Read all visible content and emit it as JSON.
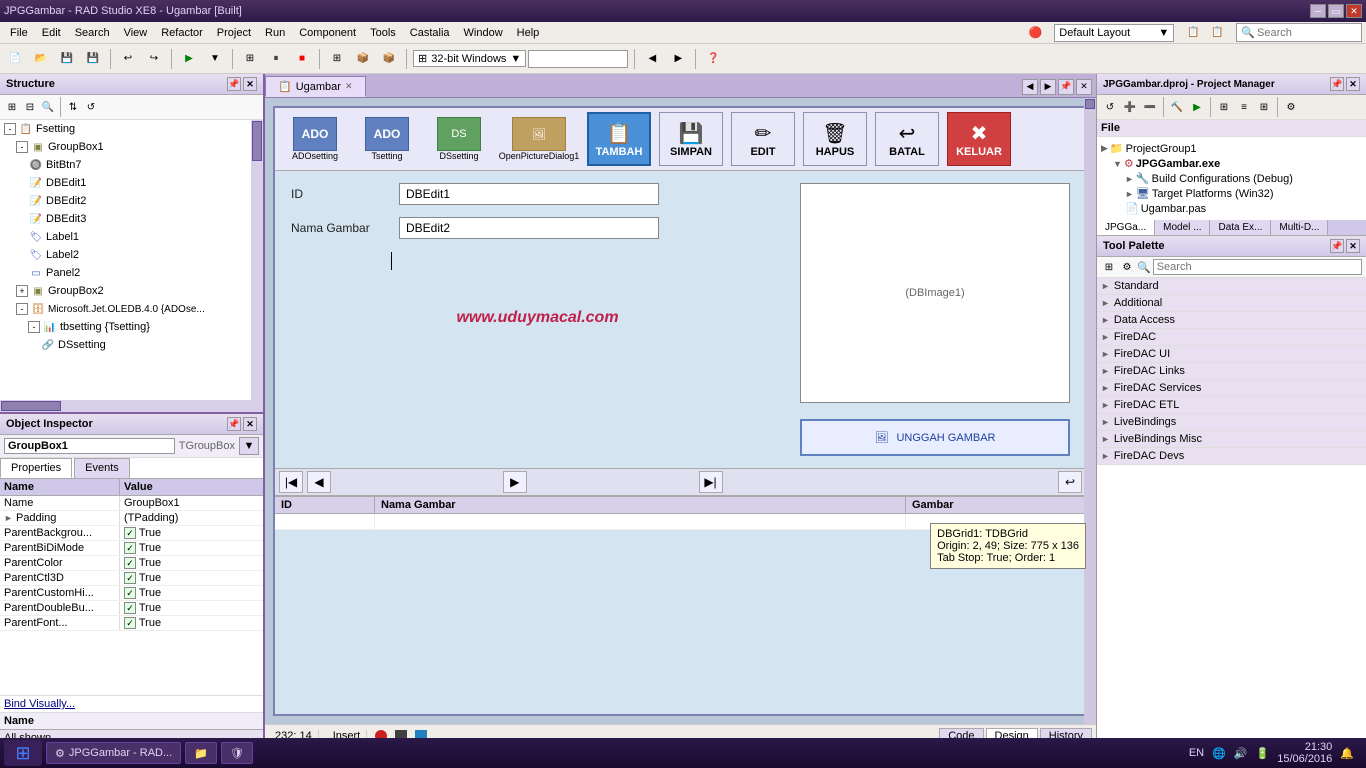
{
  "titleBar": {
    "title": "JPGGambar - RAD Studio XE8 - Ugambar [Built]",
    "buttons": [
      "minimize",
      "restore",
      "close"
    ]
  },
  "menuBar": {
    "items": [
      "File",
      "Edit",
      "Search",
      "View",
      "Refactor",
      "Project",
      "Run",
      "Component",
      "Tools",
      "Castalia",
      "Window",
      "Help"
    ]
  },
  "toolbar": {
    "layout_label": "Default Layout",
    "search_placeholder": "Search",
    "platform_label": "32-bit Windows"
  },
  "structure": {
    "title": "Structure",
    "tree": [
      {
        "label": "Fsetting",
        "level": 0,
        "expanded": true,
        "icon": "form"
      },
      {
        "label": "GroupBox1",
        "level": 1,
        "expanded": true,
        "icon": "group"
      },
      {
        "label": "BitBtn7",
        "level": 2,
        "expanded": false,
        "icon": "btn"
      },
      {
        "label": "DBEdit1",
        "level": 2,
        "expanded": false,
        "icon": "edit"
      },
      {
        "label": "DBEdit2",
        "level": 2,
        "expanded": false,
        "icon": "edit"
      },
      {
        "label": "DBEdit3",
        "level": 2,
        "expanded": false,
        "icon": "edit"
      },
      {
        "label": "Label1",
        "level": 2,
        "expanded": false,
        "icon": "label"
      },
      {
        "label": "Label2",
        "level": 2,
        "expanded": false,
        "icon": "label"
      },
      {
        "label": "Panel2",
        "level": 2,
        "expanded": false,
        "icon": "panel"
      },
      {
        "label": "GroupBox2",
        "level": 1,
        "expanded": false,
        "icon": "group"
      },
      {
        "label": "Microsoft.Jet.OLEDB.4.0 {ADOse...",
        "level": 1,
        "expanded": false,
        "icon": "db"
      },
      {
        "label": "tbsetting {Tsetting}",
        "level": 2,
        "expanded": true,
        "icon": "table"
      },
      {
        "label": "DSsetting",
        "level": 3,
        "expanded": false,
        "icon": "ds"
      }
    ]
  },
  "objectInspector": {
    "title": "Object Inspector",
    "selected_component": "GroupBox1",
    "selected_type": "TGroupBox",
    "tabs": [
      "Properties",
      "Events"
    ],
    "active_tab": "Properties",
    "columns": [
      "Name",
      "Value"
    ],
    "properties": [
      {
        "name": "Name",
        "value": "GroupBox1",
        "has_expand": false
      },
      {
        "name": "Padding",
        "value": "(TPadding)",
        "has_expand": true
      },
      {
        "name": "ParentBackgrou...",
        "value": "True",
        "has_check": true
      },
      {
        "name": "ParentBiDiMode",
        "value": "True",
        "has_check": true
      },
      {
        "name": "ParentColor",
        "value": "True",
        "has_check": true
      },
      {
        "name": "ParentCtl3D",
        "value": "True",
        "has_check": true
      },
      {
        "name": "ParentCustomHi...",
        "value": "True",
        "has_check": true
      },
      {
        "name": "ParentDoubleBu...",
        "value": "True",
        "has_check": true
      },
      {
        "name": "ParentFont...",
        "value": "True",
        "has_check": true
      }
    ],
    "bind_label": "Bind Visually...",
    "bottom_label": "Name",
    "status": "All shown"
  },
  "mainEditor": {
    "tabs": [
      {
        "label": "Ugambar",
        "active": true,
        "icon": "form"
      }
    ],
    "formButtons": [
      {
        "label": "ADOsetting",
        "icon": "ADO",
        "type": "component"
      },
      {
        "label": "Tsetting",
        "icon": "ADO",
        "type": "component"
      },
      {
        "label": "DSsetting",
        "icon": "DS",
        "type": "component"
      },
      {
        "label": "OpenPictureDialog1",
        "icon": "OPD",
        "type": "component"
      },
      {
        "label": "TAMBAH",
        "icon": "+",
        "type": "action",
        "highlight": true
      },
      {
        "label": "SIMPAN",
        "icon": "💾",
        "type": "action"
      },
      {
        "label": "EDIT",
        "icon": "✏",
        "type": "action"
      },
      {
        "label": "HAPUS",
        "icon": "🗑",
        "type": "action"
      },
      {
        "label": "BATAL",
        "icon": "✗",
        "type": "action"
      },
      {
        "label": "KELUAR",
        "icon": "✖",
        "type": "action",
        "red": true
      }
    ],
    "fields": [
      {
        "label": "ID",
        "value": "DBEdit1"
      },
      {
        "label": "Nama Gambar",
        "value": "DBEdit2"
      }
    ],
    "imageBox": "(DBImage1)",
    "uploadBtn": "UNGGAH GAMBAR",
    "watermark": "www.uduymacal.com",
    "gridColumns": [
      "ID",
      "Nama Gambar",
      "Gambar"
    ],
    "tooltip": {
      "line1": "DBGrid1: TDBGrid",
      "line2": "Origin: 2, 49; Size: 775 x 136",
      "line3": "Tab Stop: True; Order: 1"
    }
  },
  "statusBar": {
    "cursor": "232:  14",
    "mode": "Insert",
    "tabs": [
      "Code",
      "Design",
      "History"
    ],
    "active_tab": "Design"
  },
  "projectManager": {
    "title": "JPGGambar.dproj - Project Manager",
    "file_section": "File",
    "project_group": "ProjectGroup1",
    "project": "JPGGambar.exe",
    "items": [
      {
        "label": "Build Configurations (Debug)",
        "level": 2
      },
      {
        "label": "Target Platforms (Win32)",
        "level": 2
      },
      {
        "label": "Ugambar.pas",
        "level": 2
      }
    ],
    "bottom_tabs": [
      "JPGGa...",
      "Model ...",
      "Data Ex...",
      "Multi-D..."
    ],
    "active_tab": "JPGGa..."
  },
  "toolPalette": {
    "title": "Tool Palette",
    "search_placeholder": "Search",
    "categories": [
      {
        "label": "Standard",
        "expanded": false
      },
      {
        "label": "Additional",
        "expanded": false
      },
      {
        "label": "Data Access",
        "expanded": false
      },
      {
        "label": "FireDAC",
        "expanded": false
      },
      {
        "label": "FireDAC UI",
        "expanded": false
      },
      {
        "label": "FireDAC Links",
        "expanded": false
      },
      {
        "label": "FireDAC Services",
        "expanded": false
      },
      {
        "label": "FireDAC ETL",
        "expanded": false
      },
      {
        "label": "LiveBindings",
        "expanded": false
      },
      {
        "label": "LiveBindings Misc",
        "expanded": false
      },
      {
        "label": "FireDAC Devs",
        "expanded": false
      }
    ]
  },
  "taskbar": {
    "apps": [
      {
        "label": "JPGGambar - RAD...",
        "icon": "⚙"
      }
    ],
    "clock": "21:30",
    "date": "15/06/2016",
    "language": "EN"
  }
}
